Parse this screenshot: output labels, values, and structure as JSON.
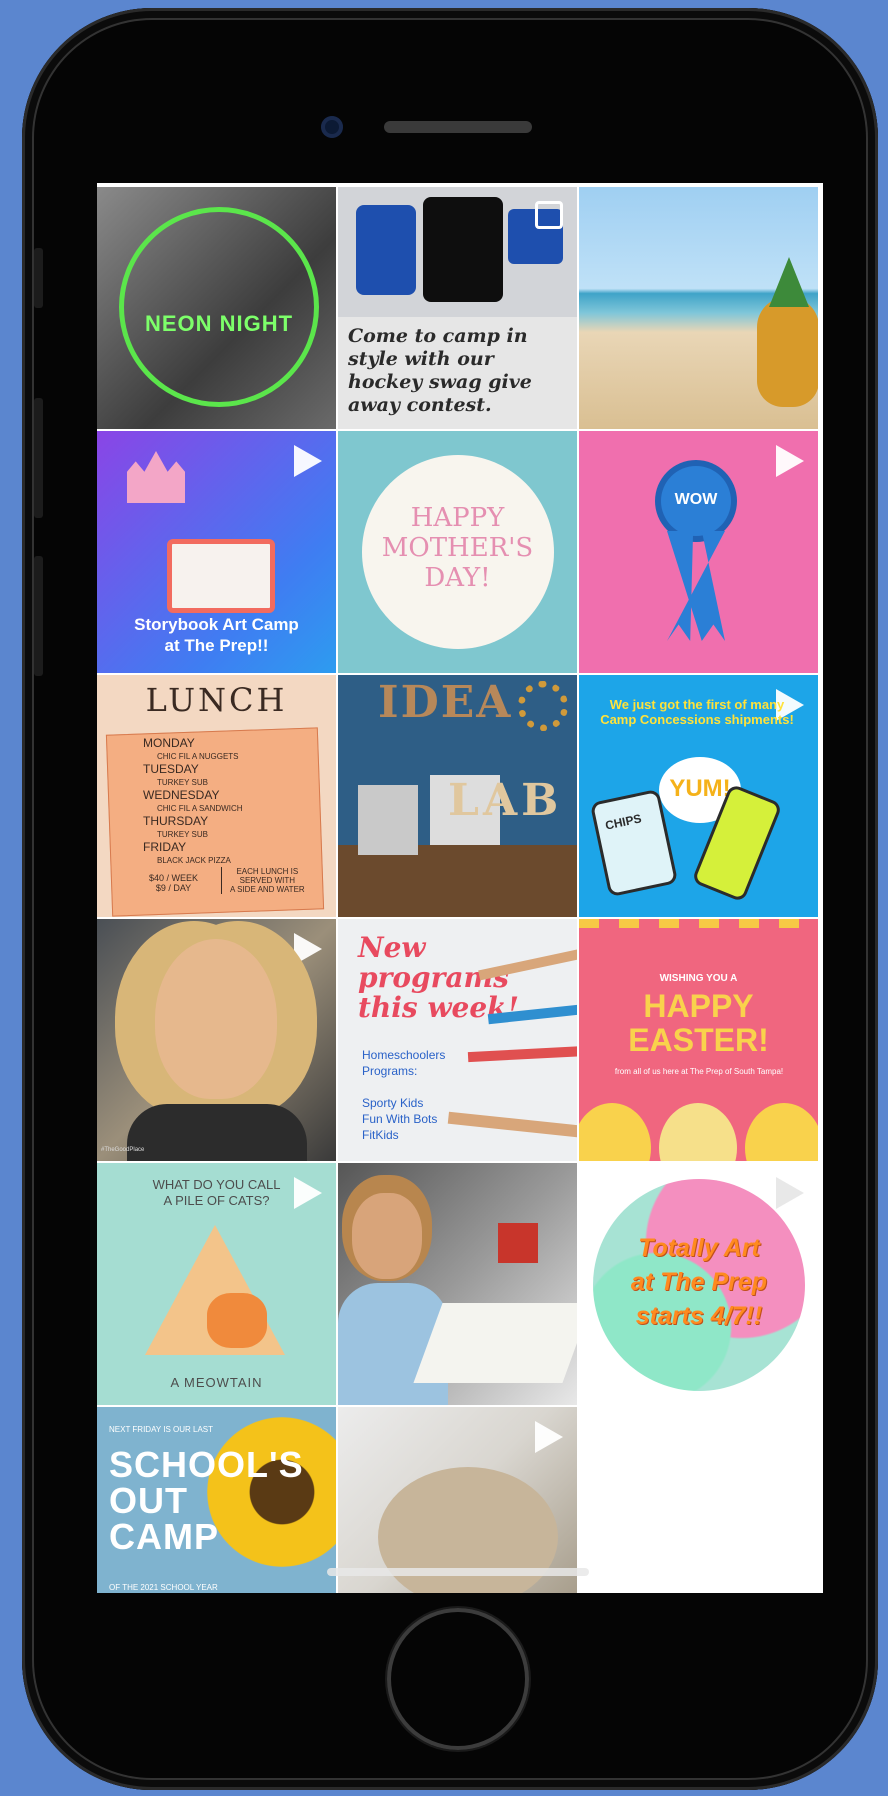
{
  "tiles": {
    "t1": {
      "text": "NEON NIGHT"
    },
    "t2": {
      "caption": "Come to camp in style with our hockey swag give away contest."
    },
    "t4": {
      "line1": "Storybook Art Camp",
      "line2": "at The Prep!!"
    },
    "t5": {
      "l1": "HAPPY",
      "l2": "MOTHER'S",
      "l3": "DAY!"
    },
    "t6": {
      "badge": "WOW"
    },
    "t7": {
      "title": "LUNCH",
      "days": [
        {
          "day": "MONDAY",
          "item": "CHIC FIL A NUGGETS"
        },
        {
          "day": "TUESDAY",
          "item": "TURKEY SUB"
        },
        {
          "day": "WEDNESDAY",
          "item": "CHIC FIL A SANDWICH"
        },
        {
          "day": "THURSDAY",
          "item": "TURKEY SUB"
        },
        {
          "day": "FRIDAY",
          "item": "BLACK JACK PIZZA"
        }
      ],
      "price1": "$40 / WEEK",
      "price2": "$9 / DAY",
      "note1": "EACH LUNCH IS",
      "note2": "SERVED WITH",
      "note3": "A SIDE AND WATER"
    },
    "t8": {
      "word": "IDEA",
      "lab": "LAB"
    },
    "t9": {
      "headline": "We just got the first of many Camp Concessions shipments!",
      "yum": "YUM!",
      "chips": "CHIPS"
    },
    "t10": {
      "tag": "#TheGoodPlace"
    },
    "t11": {
      "h1": "New",
      "h2": "programs",
      "h3": "this week!",
      "list": [
        "Homeschoolers",
        "Programs:",
        "",
        "Sporty Kids",
        "Fun With Bots",
        "FitKids"
      ]
    },
    "t12": {
      "small": "WISHING YOU A",
      "h1": "HAPPY",
      "h2": "EASTER!",
      "sub": "from all of us here at The Prep of South Tampa!"
    },
    "t13": {
      "q1": "WHAT DO YOU CALL",
      "q2": "A PILE OF CATS?",
      "a": "A MEOWTAIN"
    },
    "t15": {
      "l1": "Totally Art",
      "l2": "at The Prep",
      "l3": "starts 4/7!!"
    },
    "t16": {
      "top": "NEXT FRIDAY IS OUR LAST",
      "l1": "SCHOOL'S",
      "l2": "OUT",
      "l3": "CAMP",
      "bottom": "OF THE 2021 SCHOOL YEAR"
    }
  },
  "colors": {
    "page_bg": "#5b86cf",
    "phone": "#050505",
    "neon": "#5be64b"
  },
  "icons": {
    "video": "play-icon",
    "carousel": "multi-photo-icon"
  }
}
